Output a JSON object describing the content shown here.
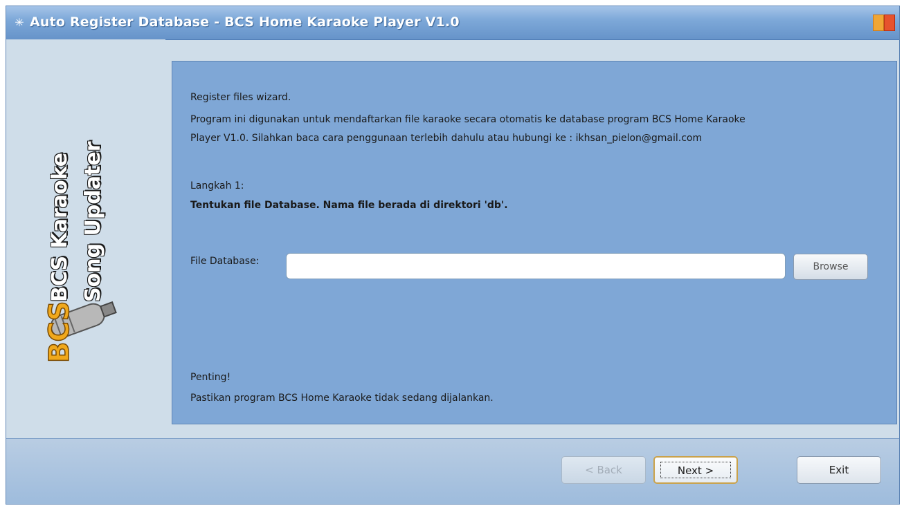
{
  "window": {
    "title": "Auto Register Database - BCS Home Karaoke Player V1.0"
  },
  "sidebar": {
    "brand_line1": "BCS Karaoke",
    "brand_line2": "Song Updater",
    "logo_icon": "bcs-microphone-logo"
  },
  "content": {
    "heading": "Register files wizard.",
    "description_line1": "Program ini digunakan untuk mendaftarkan file karaoke secara otomatis ke database program BCS Home Karaoke",
    "description_line2": "Player V1.0. Silahkan baca cara penggunaan terlebih dahulu atau hubungi ke : ikhsan_pielon@gmail.com",
    "step_label": "Langkah 1:",
    "step_instruction": "Tentukan file Database. Nama file berada di direktori 'db'.",
    "field_label": "File Database:",
    "field_value": "",
    "browse_label": "Browse",
    "note_title": "Penting!",
    "note_text": "Pastikan program BCS Home Karaoke tidak sedang dijalankan."
  },
  "footer": {
    "back_label": "< Back",
    "next_label": "Next >",
    "exit_label": "Exit"
  },
  "colors": {
    "titlebar": "#7ea9d9",
    "content_panel": "#7fa7d6",
    "window_bg": "#cfdde9"
  }
}
